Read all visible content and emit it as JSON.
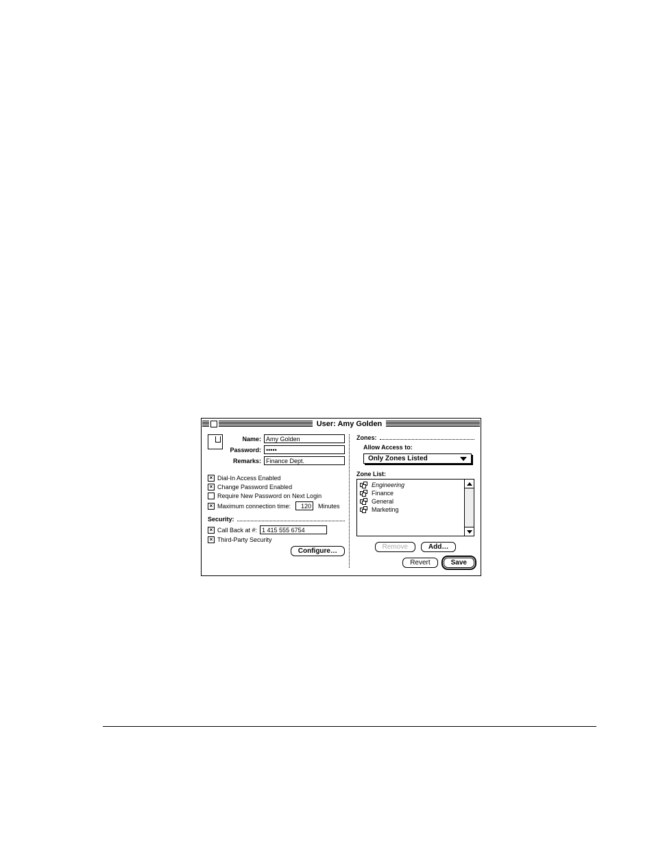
{
  "window": {
    "title": "User: Amy Golden"
  },
  "user": {
    "name_label": "Name:",
    "name": "Amy Golden",
    "password_label": "Password:",
    "password": "•••••",
    "remarks_label": "Remarks:",
    "remarks": "Finance Dept."
  },
  "options": {
    "dial_in": "Dial-In Access Enabled",
    "change_pw": "Change Password Enabled",
    "require_new_pw": "Require New Password on Next Login",
    "max_conn_prefix": "Maximum connection time:",
    "max_conn_value": "120",
    "max_conn_suffix": "Minutes"
  },
  "security": {
    "heading": "Security:",
    "callback_label": "Call Back at #:",
    "callback_value": "1 415 555 6754",
    "third_party": "Third-Party Security",
    "configure": "Configure…"
  },
  "zones": {
    "heading": "Zones:",
    "allow_label": "Allow Access to:",
    "allow_value": "Only Zones Listed",
    "list_label": "Zone List:",
    "items": [
      "Engineering",
      "Finance",
      "General",
      "Marketing"
    ],
    "remove": "Remove",
    "add": "Add…"
  },
  "footer": {
    "revert": "Revert",
    "save": "Save"
  }
}
